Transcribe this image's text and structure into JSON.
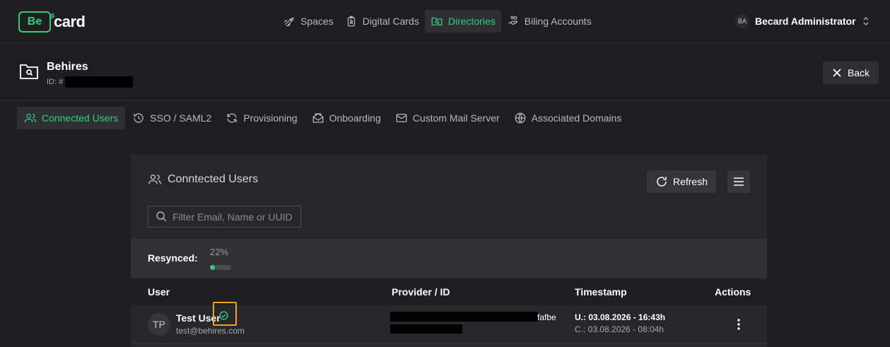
{
  "brand": {
    "logo_box": "Be",
    "logo_word": "card",
    "accent": "#2fd07a"
  },
  "nav": {
    "items": [
      {
        "label": "Spaces",
        "icon": "rocket-icon"
      },
      {
        "label": "Digital Cards",
        "icon": "badge-icon"
      },
      {
        "label": "Directories",
        "icon": "folder-search-icon",
        "active": true
      },
      {
        "label": "Biling Accounts",
        "icon": "hand-coins-icon"
      }
    ]
  },
  "user": {
    "initials": "BA",
    "name": "Becard Administrator"
  },
  "directory": {
    "title": "Behires",
    "id_prefix": "ID: #"
  },
  "back_label": "Back",
  "tabs": [
    {
      "label": "Connected Users",
      "icon": "users-icon",
      "active": true
    },
    {
      "label": "SSO / SAML2",
      "icon": "history-icon"
    },
    {
      "label": "Provisioning",
      "icon": "refresh-icon"
    },
    {
      "label": "Onboarding",
      "icon": "mail-open-icon"
    },
    {
      "label": "Custom Mail Server",
      "icon": "mail-icon"
    },
    {
      "label": "Associated Domains",
      "icon": "globe-icon"
    }
  ],
  "panel": {
    "title": "Conntected Users",
    "refresh_label": "Refresh",
    "search_placeholder": "Filter Email, Name or UUID",
    "resync_label": "Resynced:",
    "resync_percent_text": "22%",
    "resync_fraction": 0.22,
    "columns": [
      "User",
      "Provider / ID",
      "Timestamp",
      "Actions"
    ],
    "rows": [
      {
        "initials": "TP",
        "name": "Test User",
        "email": "test@behires.com",
        "provider_suffix": "fafbe",
        "updated": "U.: 03.08.2026 - 16:43h",
        "created": "C.: 03.08.2026 - 08:04h"
      }
    ]
  }
}
